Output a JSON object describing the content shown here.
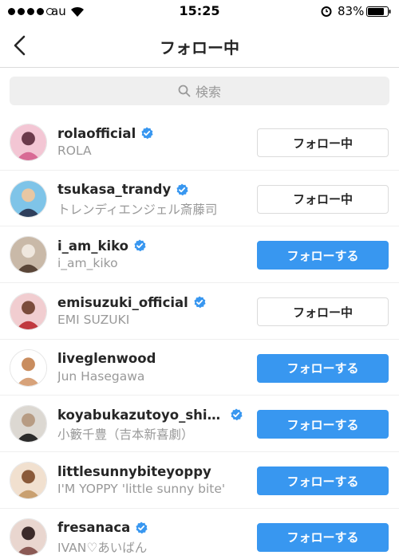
{
  "status_bar": {
    "carrier": "au",
    "time": "15:25",
    "battery": "83%",
    "signal_bars": 4,
    "icons": [
      "signal-dots",
      "wifi-icon",
      "alarm-icon",
      "battery-icon"
    ]
  },
  "header": {
    "title": "フォロー中",
    "back_icon": "chevron-left-icon"
  },
  "search": {
    "placeholder": "検索",
    "icon": "search-icon"
  },
  "colors": {
    "follow_button": "#3897f0",
    "verified_badge": "#3897f0",
    "secondary_text": "#999999",
    "search_bg": "#efefef"
  },
  "users": [
    {
      "username": "rolaofficial",
      "full_name": "ROLA",
      "verified": true,
      "button": "フォロー中",
      "following": true
    },
    {
      "username": "tsukasa_trandy",
      "full_name": "トレンディエンジェル斎藤司",
      "verified": true,
      "button": "フォロー中",
      "following": true
    },
    {
      "username": "i_am_kiko",
      "full_name": "i_am_kiko",
      "verified": true,
      "button": "フォローする",
      "following": false
    },
    {
      "username": "emisuzuki_official",
      "full_name": "EMI SUZUKI",
      "verified": true,
      "button": "フォロー中",
      "following": true
    },
    {
      "username": "liveglenwood",
      "full_name": "Jun Hasegawa",
      "verified": false,
      "button": "フォローする",
      "following": false
    },
    {
      "username": "koyabukazutoyo_shin...",
      "full_name": "小籔千豊（吉本新喜劇）",
      "verified": true,
      "button": "フォローする",
      "following": false
    },
    {
      "username": "littlesunnybiteyoppy",
      "full_name": "I'M YOPPY 'little sunny bite'",
      "verified": false,
      "button": "フォローする",
      "following": false
    },
    {
      "username": "fresanaca",
      "full_name": "IVAN♡あいばん",
      "verified": true,
      "button": "フォローする",
      "following": false
    }
  ]
}
